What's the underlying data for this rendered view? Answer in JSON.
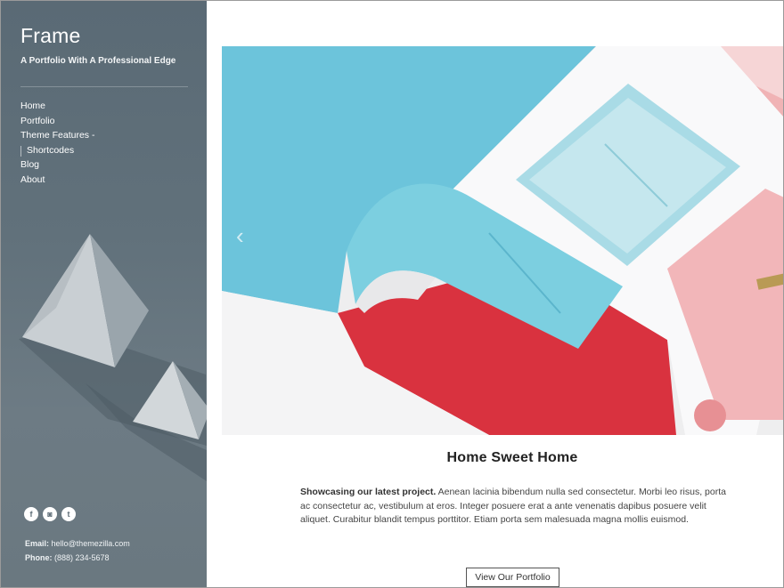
{
  "site": {
    "title": "Frame",
    "description": "A Portfolio With A Professional Edge"
  },
  "nav": {
    "items": [
      {
        "label": "Home"
      },
      {
        "label": "Portfolio"
      },
      {
        "label": "Theme Features -"
      },
      {
        "label": "Shortcodes"
      },
      {
        "label": "Blog"
      },
      {
        "label": "About"
      }
    ]
  },
  "social": {
    "icons": [
      {
        "name": "facebook-icon",
        "glyph": "f"
      },
      {
        "name": "instagram-icon",
        "glyph": "◙"
      },
      {
        "name": "twitter-icon",
        "glyph": "t"
      }
    ]
  },
  "contact": {
    "email_label": "Email:",
    "email_value": "hello@themezilla.com",
    "phone_label": "Phone:",
    "phone_value": "(888) 234-5678"
  },
  "slider": {
    "prev_glyph": "‹"
  },
  "main": {
    "heading": "Home Sweet Home",
    "intro_bold": "Showcasing our latest project.",
    "intro_text": " Aenean lacinia bibendum nulla sed consectetur. Morbi leo risus, porta ac consectetur ac, vestibulum at eros. Integer posuere erat a ante venenatis dapibus posuere velit aliquet. Curabitur blandit tempus porttitor. Etiam porta sem malesuada magna mollis euismod.",
    "button_label": "View Our Portfolio"
  }
}
